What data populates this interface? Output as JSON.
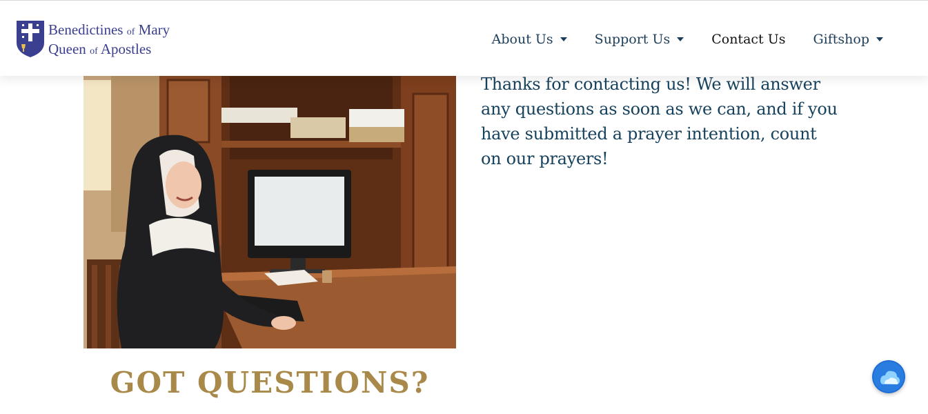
{
  "brand": {
    "line1_main": "Benedictines",
    "line1_of": "of",
    "line1_end": "Mary",
    "line2_main": "Queen",
    "line2_of": "of",
    "line2_end": "Apostles",
    "logo_icon": "cross-shield-icon"
  },
  "nav": {
    "items": [
      {
        "label": "About Us",
        "has_dropdown": true
      },
      {
        "label": "Support Us",
        "has_dropdown": true
      },
      {
        "label": "Contact Us",
        "has_dropdown": false,
        "active": true
      },
      {
        "label": "Giftshop",
        "has_dropdown": true
      }
    ]
  },
  "main": {
    "message": "Thanks for contacting us! We will answer any questions as soon as we can, and if you have submitted a prayer intention, count on our prayers!",
    "heading": "GOT QUESTIONS?",
    "photo_icon": "photo-nun-at-computer"
  },
  "widget": {
    "icon": "cloud-chat-icon"
  },
  "colors": {
    "brand_blue": "#3a3f8f",
    "nav_text": "#1c3d5a",
    "message_text": "#17425e",
    "heading_gold": "#a8894a",
    "chat_blue": "#1f6fd6"
  }
}
